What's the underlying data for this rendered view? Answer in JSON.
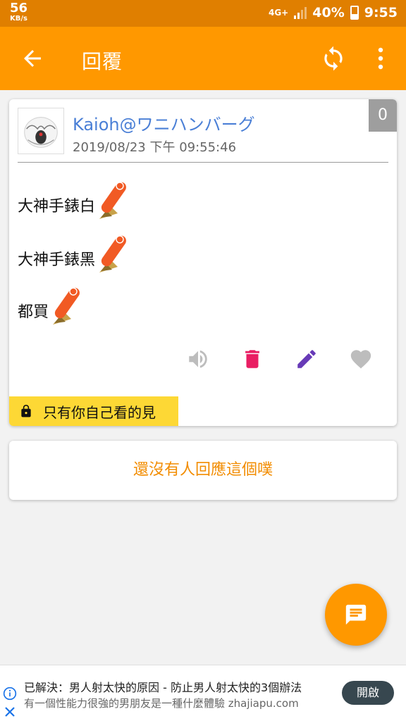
{
  "status_bar": {
    "speed": "56",
    "speed_unit": "KB/s",
    "network": "4G+",
    "battery": "40%",
    "time": "9:55"
  },
  "app_bar": {
    "title": "回覆",
    "back_icon": "arrow-left-icon",
    "refresh_icon": "refresh-icon",
    "more_icon": "more-vert-icon"
  },
  "post": {
    "author": "Kaioh@ワニハンバーグ",
    "timestamp": "2019/08/23 下午 09:55:46",
    "count_badge": "0",
    "lines": [
      "大神手錶白",
      "大神手錶黑",
      "都買"
    ],
    "sticker_icon": "lucky-stick-emoji-icon",
    "actions": [
      {
        "icon": "volume-icon",
        "color": "#bdbdbd"
      },
      {
        "icon": "trash-icon",
        "color": "#e91e63"
      },
      {
        "icon": "pencil-icon",
        "color": "#673ab7"
      },
      {
        "icon": "heart-icon",
        "color": "#bdbdbd"
      }
    ],
    "privacy_label": "只有你自己看的見"
  },
  "replies": {
    "empty_text": "還沒有人回應這個噗"
  },
  "fab": {
    "icon": "comment-icon"
  },
  "ad": {
    "title": "已解決：男人射太快的原因 - 防止男人射太快的3個辦法",
    "subtitle": "有一個性能力很強的男朋友是一種什麼體驗 zhajiapu.com",
    "open_label": "開啟"
  },
  "colors": {
    "status_bar": "#e07f00",
    "app_bar": "#ff9800",
    "accent_text": "#f28c00",
    "author": "#4a7fd6",
    "privacy_bg": "#fdd835"
  }
}
